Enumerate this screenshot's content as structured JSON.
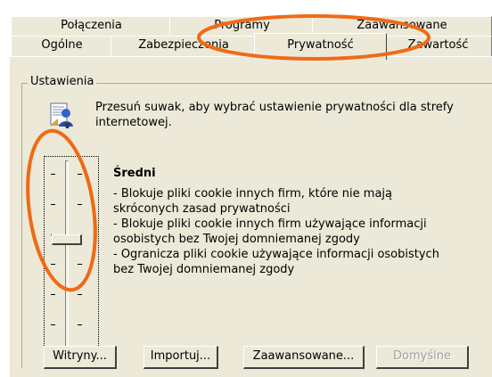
{
  "tabs": {
    "back_row": [
      {
        "label": "Połączenia",
        "accel": ""
      },
      {
        "label": "Programy",
        "accel": ""
      },
      {
        "label": "Zaawansowane",
        "accel": ""
      }
    ],
    "front_row": [
      {
        "label": "Ogólne",
        "accel": ""
      },
      {
        "label": "Zabezpieczenia",
        "accel": ""
      },
      {
        "label": "Prywatność",
        "accel": ""
      },
      {
        "label": "Zawartość",
        "accel": ""
      }
    ]
  },
  "settings": {
    "group_title": "Ustawienia",
    "instruction": "Przesuń suwak, aby wybrać ustawienie prywatności dla strefy internetowej.",
    "level": {
      "name": "Średni",
      "description": "- Blokuje pliki cookie innych firm, które nie mają skróconych zasad prywatności\n- Blokuje pliki cookie innych firm używające informacji osobistych bez Twojej domniemanej zgody\n- Ogranicza pliki cookie używające informacji osobistych bez Twojej domniemanej zgody"
    }
  },
  "buttons": {
    "sites": {
      "label": "Witryny...",
      "accel_char": "W"
    },
    "import": {
      "label": "Importuj...",
      "accel_char": "I"
    },
    "advanced": {
      "label": "Zaawansowane...",
      "accel_char": "a"
    },
    "default": {
      "label": "Domyślne",
      "accel_char": "D"
    }
  },
  "colors": {
    "dialog_face": "#ece9d8",
    "annotation": "#f06a16"
  },
  "icons": {
    "privacy": "privacy-shield-person-icon"
  },
  "slider": {
    "selected_level": "Średni"
  }
}
